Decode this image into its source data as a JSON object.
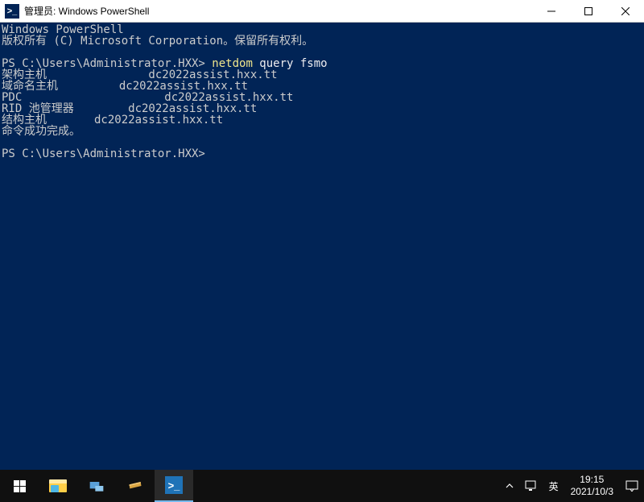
{
  "window": {
    "title": "管理员: Windows PowerShell"
  },
  "terminal": {
    "header1": "Windows PowerShell",
    "header2": "版权所有 (C) Microsoft Corporation。保留所有权利。",
    "prompt1": "PS C:\\Users\\Administrator.HXX> ",
    "cmd_part1": "netdom",
    "cmd_part2": " query fsmo",
    "out1": "架构主机               dc2022assist.hxx.tt",
    "out2": "域命名主机         dc2022assist.hxx.tt",
    "out3": "PDC                     dc2022assist.hxx.tt",
    "out4": "RID 池管理器        dc2022assist.hxx.tt",
    "out5": "结构主机       dc2022assist.hxx.tt",
    "out6": "命令成功完成。",
    "prompt2": "PS C:\\Users\\Administrator.HXX> "
  },
  "taskbar": {
    "ime": "英",
    "time": "19:15",
    "date": "2021/10/3"
  }
}
